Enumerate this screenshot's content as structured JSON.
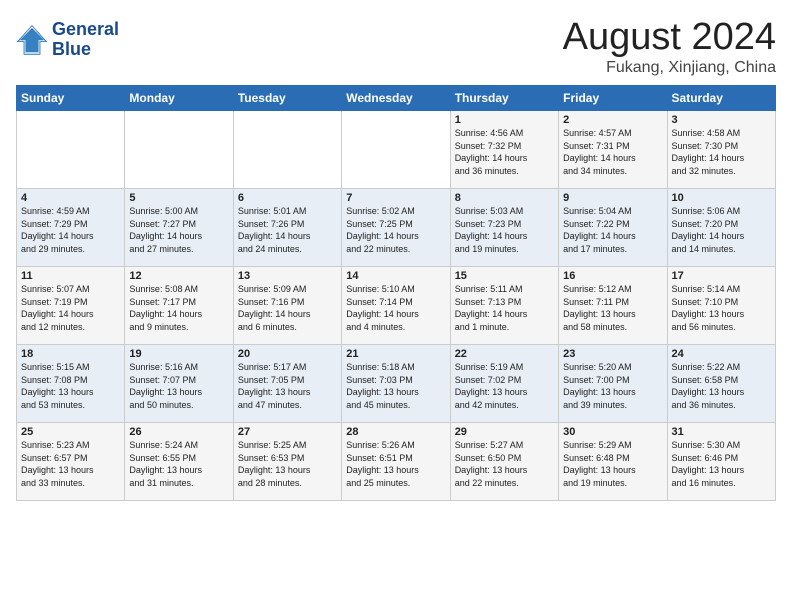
{
  "logo": {
    "line1": "General",
    "line2": "Blue"
  },
  "header": {
    "month": "August 2024",
    "location": "Fukang, Xinjiang, China"
  },
  "days_of_week": [
    "Sunday",
    "Monday",
    "Tuesday",
    "Wednesday",
    "Thursday",
    "Friday",
    "Saturday"
  ],
  "weeks": [
    [
      {
        "day": "",
        "info": ""
      },
      {
        "day": "",
        "info": ""
      },
      {
        "day": "",
        "info": ""
      },
      {
        "day": "",
        "info": ""
      },
      {
        "day": "1",
        "info": "Sunrise: 4:56 AM\nSunset: 7:32 PM\nDaylight: 14 hours\nand 36 minutes."
      },
      {
        "day": "2",
        "info": "Sunrise: 4:57 AM\nSunset: 7:31 PM\nDaylight: 14 hours\nand 34 minutes."
      },
      {
        "day": "3",
        "info": "Sunrise: 4:58 AM\nSunset: 7:30 PM\nDaylight: 14 hours\nand 32 minutes."
      }
    ],
    [
      {
        "day": "4",
        "info": "Sunrise: 4:59 AM\nSunset: 7:29 PM\nDaylight: 14 hours\nand 29 minutes."
      },
      {
        "day": "5",
        "info": "Sunrise: 5:00 AM\nSunset: 7:27 PM\nDaylight: 14 hours\nand 27 minutes."
      },
      {
        "day": "6",
        "info": "Sunrise: 5:01 AM\nSunset: 7:26 PM\nDaylight: 14 hours\nand 24 minutes."
      },
      {
        "day": "7",
        "info": "Sunrise: 5:02 AM\nSunset: 7:25 PM\nDaylight: 14 hours\nand 22 minutes."
      },
      {
        "day": "8",
        "info": "Sunrise: 5:03 AM\nSunset: 7:23 PM\nDaylight: 14 hours\nand 19 minutes."
      },
      {
        "day": "9",
        "info": "Sunrise: 5:04 AM\nSunset: 7:22 PM\nDaylight: 14 hours\nand 17 minutes."
      },
      {
        "day": "10",
        "info": "Sunrise: 5:06 AM\nSunset: 7:20 PM\nDaylight: 14 hours\nand 14 minutes."
      }
    ],
    [
      {
        "day": "11",
        "info": "Sunrise: 5:07 AM\nSunset: 7:19 PM\nDaylight: 14 hours\nand 12 minutes."
      },
      {
        "day": "12",
        "info": "Sunrise: 5:08 AM\nSunset: 7:17 PM\nDaylight: 14 hours\nand 9 minutes."
      },
      {
        "day": "13",
        "info": "Sunrise: 5:09 AM\nSunset: 7:16 PM\nDaylight: 14 hours\nand 6 minutes."
      },
      {
        "day": "14",
        "info": "Sunrise: 5:10 AM\nSunset: 7:14 PM\nDaylight: 14 hours\nand 4 minutes."
      },
      {
        "day": "15",
        "info": "Sunrise: 5:11 AM\nSunset: 7:13 PM\nDaylight: 14 hours\nand 1 minute."
      },
      {
        "day": "16",
        "info": "Sunrise: 5:12 AM\nSunset: 7:11 PM\nDaylight: 13 hours\nand 58 minutes."
      },
      {
        "day": "17",
        "info": "Sunrise: 5:14 AM\nSunset: 7:10 PM\nDaylight: 13 hours\nand 56 minutes."
      }
    ],
    [
      {
        "day": "18",
        "info": "Sunrise: 5:15 AM\nSunset: 7:08 PM\nDaylight: 13 hours\nand 53 minutes."
      },
      {
        "day": "19",
        "info": "Sunrise: 5:16 AM\nSunset: 7:07 PM\nDaylight: 13 hours\nand 50 minutes."
      },
      {
        "day": "20",
        "info": "Sunrise: 5:17 AM\nSunset: 7:05 PM\nDaylight: 13 hours\nand 47 minutes."
      },
      {
        "day": "21",
        "info": "Sunrise: 5:18 AM\nSunset: 7:03 PM\nDaylight: 13 hours\nand 45 minutes."
      },
      {
        "day": "22",
        "info": "Sunrise: 5:19 AM\nSunset: 7:02 PM\nDaylight: 13 hours\nand 42 minutes."
      },
      {
        "day": "23",
        "info": "Sunrise: 5:20 AM\nSunset: 7:00 PM\nDaylight: 13 hours\nand 39 minutes."
      },
      {
        "day": "24",
        "info": "Sunrise: 5:22 AM\nSunset: 6:58 PM\nDaylight: 13 hours\nand 36 minutes."
      }
    ],
    [
      {
        "day": "25",
        "info": "Sunrise: 5:23 AM\nSunset: 6:57 PM\nDaylight: 13 hours\nand 33 minutes."
      },
      {
        "day": "26",
        "info": "Sunrise: 5:24 AM\nSunset: 6:55 PM\nDaylight: 13 hours\nand 31 minutes."
      },
      {
        "day": "27",
        "info": "Sunrise: 5:25 AM\nSunset: 6:53 PM\nDaylight: 13 hours\nand 28 minutes."
      },
      {
        "day": "28",
        "info": "Sunrise: 5:26 AM\nSunset: 6:51 PM\nDaylight: 13 hours\nand 25 minutes."
      },
      {
        "day": "29",
        "info": "Sunrise: 5:27 AM\nSunset: 6:50 PM\nDaylight: 13 hours\nand 22 minutes."
      },
      {
        "day": "30",
        "info": "Sunrise: 5:29 AM\nSunset: 6:48 PM\nDaylight: 13 hours\nand 19 minutes."
      },
      {
        "day": "31",
        "info": "Sunrise: 5:30 AM\nSunset: 6:46 PM\nDaylight: 13 hours\nand 16 minutes."
      }
    ]
  ]
}
